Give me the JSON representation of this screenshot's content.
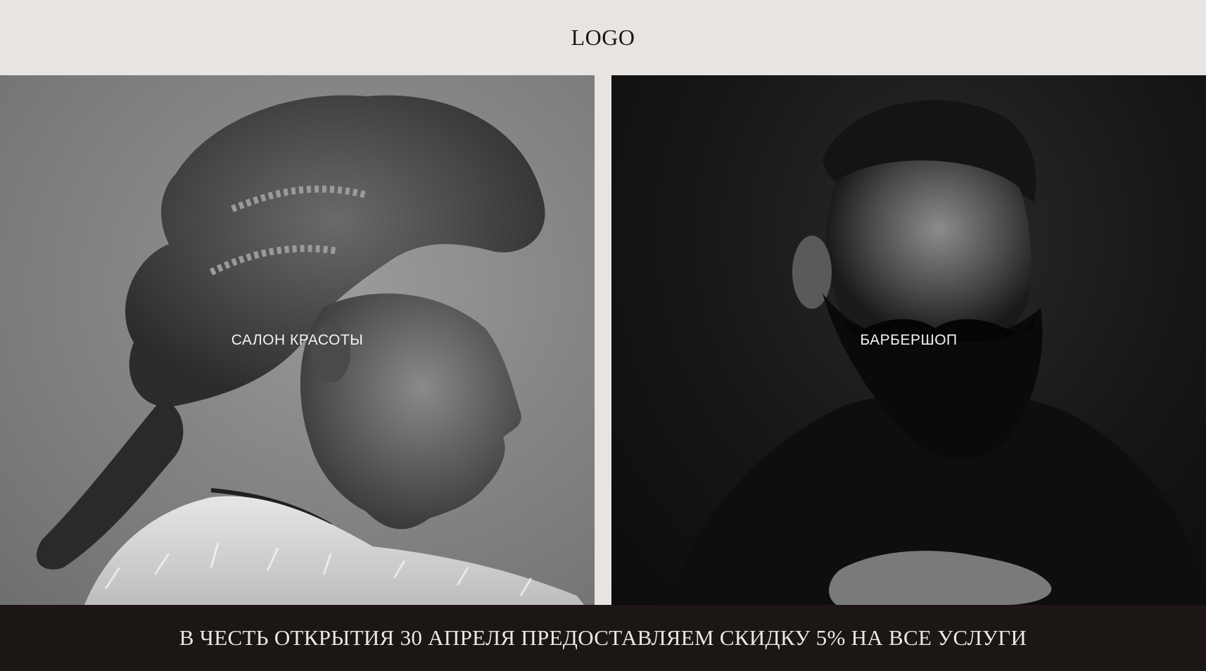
{
  "header": {
    "logo": "LOGO"
  },
  "panels": [
    {
      "label": "САЛОН КРАСОТЫ",
      "image": "woman-profile-photo"
    },
    {
      "label": "БАРБЕРШОП",
      "image": "bearded-man-photo"
    }
  ],
  "footer": {
    "promo_text": "В ЧЕСТЬ ОТКРЫТИЯ 30 АПРЕЛЯ ПРЕДОСТАВЛЯЕМ СКИДКУ 5% НА ВСЕ УСЛУГИ"
  },
  "colors": {
    "background": "#e8e4e1",
    "footer_background": "#1c1614",
    "logo_text": "#1b1614",
    "panel_text": "#f4f2f0"
  }
}
